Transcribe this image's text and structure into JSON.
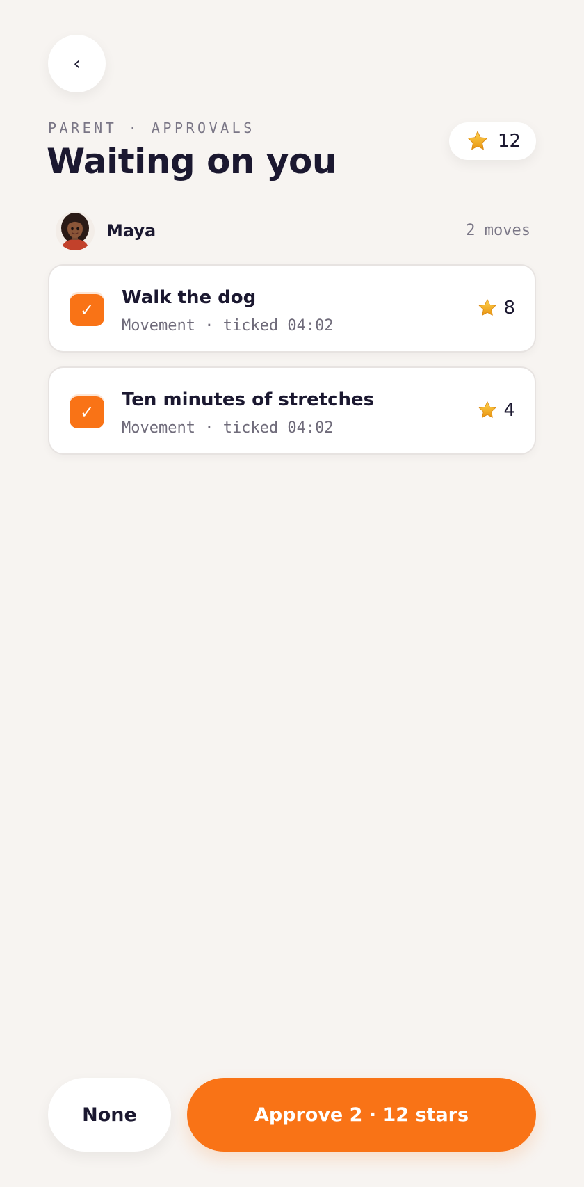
{
  "nav": {
    "back_label": "‹"
  },
  "header": {
    "eyebrow": "PARENT · APPROVALS",
    "title": "Waiting on you"
  },
  "balance": {
    "count": "12",
    "icon": "star-icon"
  },
  "kid": {
    "name": "Maya",
    "moves": "2 moves"
  },
  "tasks": [
    {
      "checked": true,
      "check_glyph": "✓",
      "title": "Walk the dog",
      "meta": "Movement · ticked 04:02",
      "stars": "8"
    },
    {
      "checked": true,
      "check_glyph": "✓",
      "title": "Ten minutes of stretches",
      "meta": "Movement · ticked 04:02",
      "stars": "4"
    }
  ],
  "actions": {
    "none_label": "None",
    "approve_label": "Approve 2 · 12 stars"
  },
  "colors": {
    "accent": "#f97316",
    "background": "#f7f4f1",
    "text": "#1b1830",
    "muted": "#7a7686",
    "star": "#f5b11c"
  }
}
